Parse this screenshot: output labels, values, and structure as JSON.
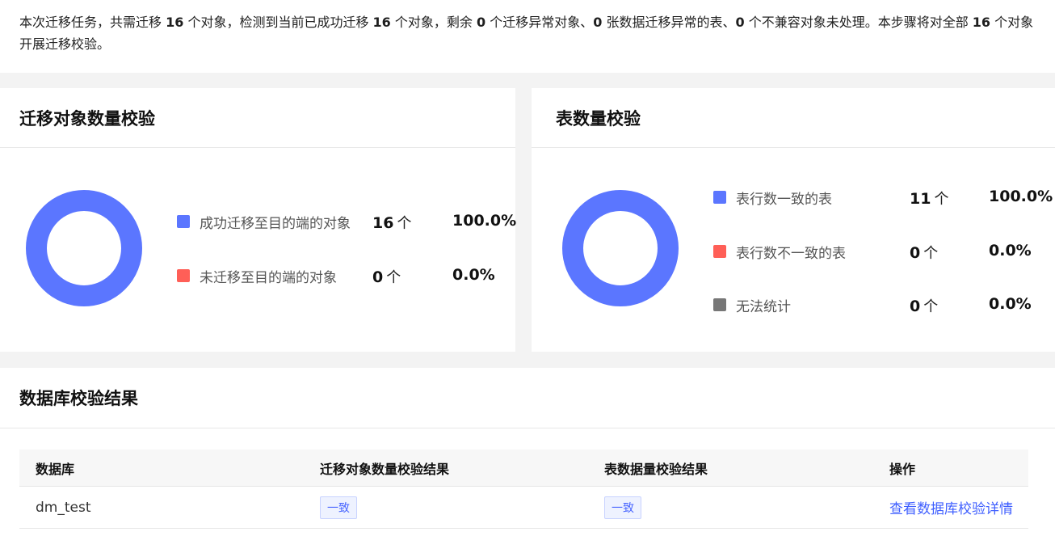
{
  "summary": {
    "p1": "本次迁移任务，共需迁移 ",
    "n1": "16",
    "p2": " 个对象，检测到当前已成功迁移 ",
    "n2": "16",
    "p3": " 个对象，剩余 ",
    "n3": "0",
    "p4": " 个迁移异常对象、",
    "n4": "0",
    "p5": " 张数据迁移异常的表、",
    "n5": "0",
    "p6": " 个不兼容对象未处理。本步骤将对全部 ",
    "n6": "16",
    "p7": " 个对象开展迁移校验。"
  },
  "migration_check": {
    "title": "迁移对象数量校验",
    "items": [
      {
        "label": "成功迁移至目的端的对象",
        "count": "16",
        "unit": "个",
        "percent": "100.0%",
        "color": "#5b76ff"
      },
      {
        "label": "未迁移至目的端的对象",
        "count": "0",
        "unit": "个",
        "percent": "0.0%",
        "color": "#ff5f57"
      }
    ],
    "donut_fraction": 1.0
  },
  "table_check": {
    "title": "表数量校验",
    "items": [
      {
        "label": "表行数一致的表",
        "count": "11",
        "unit": "个",
        "percent": "100.0%",
        "color": "#5b76ff"
      },
      {
        "label": "表行数不一致的表",
        "count": "0",
        "unit": "个",
        "percent": "0.0%",
        "color": "#ff5f57"
      },
      {
        "label": "无法统计",
        "count": "0",
        "unit": "个",
        "percent": "0.0%",
        "color": "#777777"
      }
    ],
    "donut_fraction": 1.0
  },
  "results": {
    "title": "数据库校验结果",
    "headers": [
      "数据库",
      "迁移对象数量校验结果",
      "表数据量校验结果",
      "操作"
    ],
    "rows": [
      {
        "database": "dm_test",
        "object_result": "一致",
        "table_result": "一致",
        "action": "查看数据库校验详情"
      }
    ]
  }
}
